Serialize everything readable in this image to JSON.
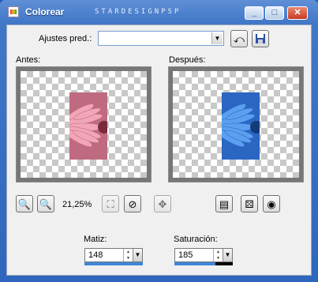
{
  "window": {
    "title": "Colorear",
    "watermark": "STARDESIGNPSP"
  },
  "presets": {
    "label": "Ajustes pred.:",
    "value": ""
  },
  "previews": {
    "before_label": "Antes:",
    "after_label": "Después:"
  },
  "zoom": {
    "value": "21,25%"
  },
  "hue": {
    "label": "Matiz:",
    "value": "148",
    "color": "#3f86d8"
  },
  "saturation": {
    "label": "Saturación:",
    "value": "185",
    "color": "#3f86d8"
  },
  "colors": {
    "before_petal": "#e3879d",
    "after_petal": "#4a8fe0",
    "preview_frame": "#777777",
    "checker": "#c8c8c8"
  }
}
